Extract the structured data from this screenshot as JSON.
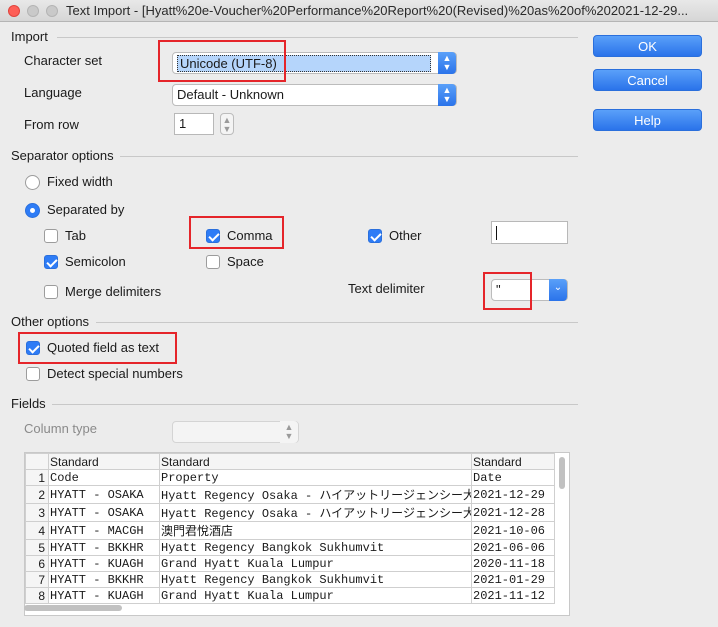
{
  "window": {
    "title": "Text Import - [Hyatt%20e-Voucher%20Performance%20Report%20(Revised)%20as%20of%202021-12-29..."
  },
  "import": {
    "section": "Import",
    "charset_label": "Character set",
    "charset_value": "Unicode (UTF-8)",
    "language_label": "Language",
    "language_value": "Default - Unknown",
    "from_row_label": "From row",
    "from_row_value": "1"
  },
  "buttons": {
    "ok": "OK",
    "cancel": "Cancel",
    "help": "Help"
  },
  "separator": {
    "section": "Separator options",
    "fixed_width": "Fixed width",
    "separated_by": "Separated by",
    "tab": "Tab",
    "comma": "Comma",
    "other": "Other",
    "other_value": "",
    "semicolon": "Semicolon",
    "space": "Space",
    "merge": "Merge delimiters",
    "text_delimiter_label": "Text delimiter",
    "text_delimiter_value": "\""
  },
  "other_options": {
    "section": "Other options",
    "quoted": "Quoted field as text",
    "detect": "Detect special numbers"
  },
  "fields": {
    "section": "Fields",
    "column_type_label": "Column type",
    "column_type_value": "",
    "headers": [
      "Standard",
      "Standard",
      "Standard"
    ],
    "rows": [
      [
        "1",
        "Code",
        "Property",
        "Date"
      ],
      [
        "2",
        "HYATT - OSAKA",
        "Hyatt Regency Osaka - ハイアットリージェンシー大阪",
        "2021-12-29"
      ],
      [
        "3",
        "HYATT - OSAKA",
        "Hyatt Regency Osaka - ハイアットリージェンシー大阪",
        "2021-12-28"
      ],
      [
        "4",
        "HYATT - MACGH",
        "澳門君悅酒店",
        "2021-10-06"
      ],
      [
        "5",
        "HYATT - BKKHR",
        "Hyatt Regency Bangkok Sukhumvit",
        "2021-06-06"
      ],
      [
        "6",
        "HYATT - KUAGH",
        "Grand Hyatt Kuala Lumpur",
        "2020-11-18"
      ],
      [
        "7",
        "HYATT - BKKHR",
        "Hyatt Regency Bangkok Sukhumvit",
        "2021-01-29"
      ],
      [
        "8",
        "HYATT - KUAGH",
        "Grand Hyatt Kuala Lumpur",
        "2021-11-12"
      ]
    ]
  },
  "colors": {
    "accent": "#2e7cf6",
    "highlight_box": "#e5252a",
    "background": "#ececec"
  }
}
